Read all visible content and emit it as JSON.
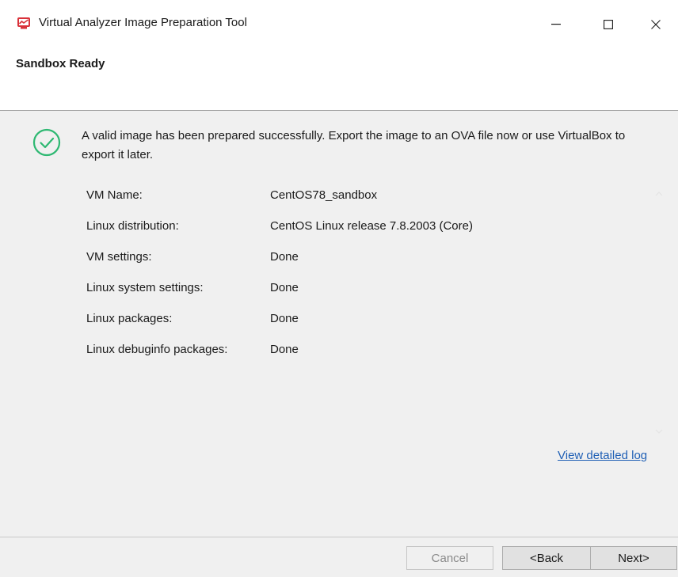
{
  "window": {
    "title": "Virtual Analyzer Image Preparation Tool",
    "icon": "app-monitor-icon",
    "controls": {
      "minimize": "minimize-icon",
      "maximize": "maximize-icon",
      "close": "close-icon"
    }
  },
  "header": {
    "title": "Sandbox Ready"
  },
  "main": {
    "status_icon": "check-circle-icon",
    "message": "A valid image has been prepared successfully. Export the image to an OVA file now or use VirtualBox to export it later.",
    "details": [
      {
        "label": "VM Name:",
        "value": "CentOS78_sandbox"
      },
      {
        "label": "Linux distribution:",
        "value": "CentOS Linux release 7.8.2003 (Core)"
      },
      {
        "label": "VM settings:",
        "value": "Done"
      },
      {
        "label": "Linux system settings:",
        "value": "Done"
      },
      {
        "label": "Linux packages:",
        "value": "Done"
      },
      {
        "label": "Linux debuginfo packages:",
        "value": "Done"
      }
    ],
    "log_link": "View detailed log"
  },
  "footer": {
    "cancel_label": "Cancel",
    "back_label": "<Back",
    "next_label": "Next>"
  },
  "colors": {
    "success": "#2eb872",
    "link": "#1f5fb5",
    "app_icon": "#d9323a"
  }
}
